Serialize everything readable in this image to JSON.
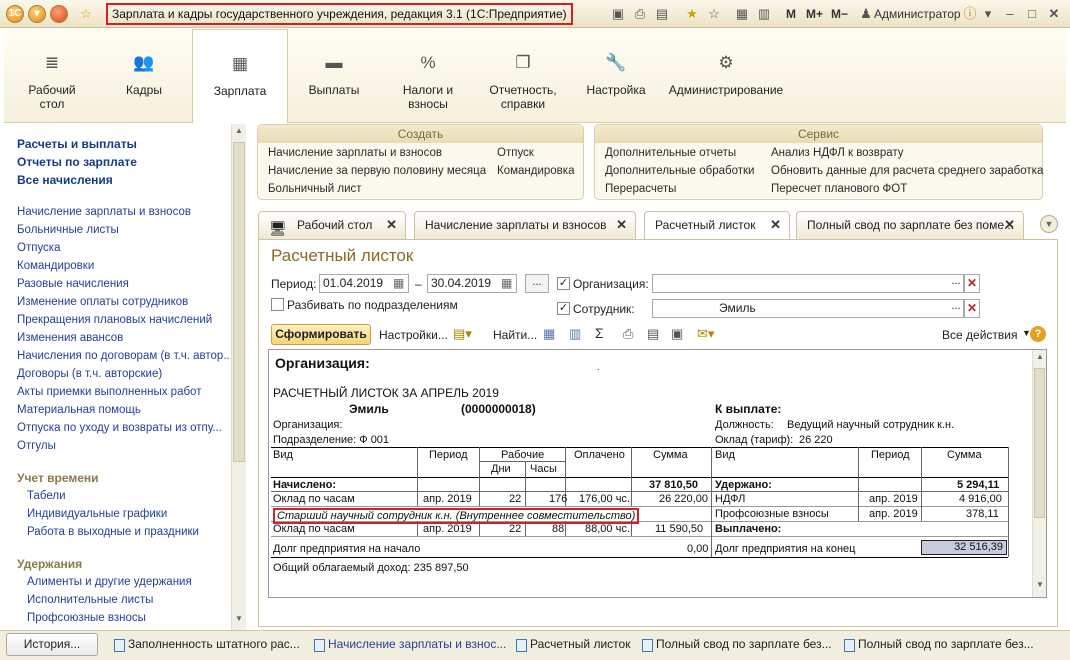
{
  "window": {
    "title": "Зарплата и кадры государственного учреждения, редакция 3.1 (1С:Предприятие)",
    "m_label": "M",
    "mplus_label": "M+",
    "mminus_label": "M−",
    "user": "Администратор"
  },
  "sections": [
    {
      "label": "Рабочий стол"
    },
    {
      "label": "Кадры"
    },
    {
      "label": "Зарплата"
    },
    {
      "label": "Выплаты"
    },
    {
      "label": "Налоги и взносы"
    },
    {
      "label": "Отчетность, справки"
    },
    {
      "label": "Настройка"
    },
    {
      "label": "Администрирование"
    }
  ],
  "left_panel": {
    "top_links": [
      "Расчеты и выплаты",
      "Отчеты по зарплате",
      "Все начисления"
    ],
    "links": [
      "Начисление зарплаты и взносов",
      "Больничные листы",
      "Отпуска",
      "Командировки",
      "Разовые начисления",
      "Изменение оплаты сотрудников",
      "Прекращения плановых начислений",
      "Изменения авансов",
      "Начисления по договорам (в т.ч. автор...",
      "Договоры (в т.ч. авторские)",
      "Акты приемки выполненных работ",
      "Материальная помощь",
      "Отпуска по уходу и возвраты из отпу...",
      "Отгулы"
    ],
    "time_head": "Учет времени",
    "time_links": [
      "Табели",
      "Индивидуальные графики",
      "Работа в выходные и праздники"
    ],
    "ded_head": "Удержания",
    "ded_links": [
      "Алименты и другие удержания",
      "Исполнительные листы",
      "Профсоюзные взносы"
    ]
  },
  "create": {
    "title": "Создать",
    "col1": [
      "Начисление зарплаты и взносов",
      "Начисление за первую половину месяца",
      "Больничный лист"
    ],
    "col2": [
      "Отпуск",
      "Командировка"
    ]
  },
  "service": {
    "title": "Сервис",
    "col1": [
      "Дополнительные отчеты",
      "Дополнительные обработки",
      "Перерасчеты"
    ],
    "col2": [
      "Анализ НДФЛ к возврату",
      "Обновить данные для расчета среднего заработка",
      "Пересчет планового ФОТ"
    ]
  },
  "tabs": [
    "Рабочий стол",
    "Начисление зарплаты и взносов",
    "Расчетный листок",
    "Полный свод по зарплате без поме..."
  ],
  "form": {
    "title": "Расчетный листок",
    "period_label": "Период:",
    "date_from": "01.04.2019",
    "dash": "–",
    "date_to": "30.04.2019",
    "ellipsis": "...",
    "split_label": "Разбивать по подразделениям",
    "org_label": "Организация:",
    "org_value": "",
    "emp_label": "Сотрудник:",
    "emp_value": "Эмиль",
    "generate": "Сформировать",
    "settings": "Настройки...",
    "find": "Найти...",
    "all_actions": "Все действия",
    "help": "?"
  },
  "report": {
    "org_header": "Организация:",
    "title": "РАСЧЕТНЫЙ ЛИСТОК ЗА АПРЕЛЬ 2019",
    "emp_name": "Эмиль",
    "emp_code": "(0000000018)",
    "to_pay": "К выплате:",
    "org_row": "Организация:",
    "position_label": "Должность:",
    "position": "Ведущий научный сотрудник к.н.",
    "dept": "Подразделение: Ф 001",
    "salary_label": "Оклад (тариф):",
    "salary": "26 220",
    "h_vid": "Вид",
    "h_period": "Период",
    "h_work": "Рабочие",
    "h_days": "Дни",
    "h_hours": "Часы",
    "h_paid": "Оплачено",
    "h_sum": "Сумма",
    "h_vid2": "Вид",
    "h_period2": "Период",
    "h_sum2": "Сумма",
    "accrued": "Начислено:",
    "accrued_sum": "37 810,50",
    "withheld": "Удержано:",
    "withheld_sum": "5 294,11",
    "r1": {
      "vid": "Оклад по часам",
      "period": "апр. 2019",
      "days": "22",
      "hours": "176",
      "paid": "176,00 чс.",
      "sum": "26 220,00"
    },
    "d1": {
      "vid": "НДФЛ",
      "period": "апр. 2019",
      "sum": "4 916,00"
    },
    "sub": "Старший научный сотрудник к.н. (Внутреннее совместительство)",
    "d2": {
      "vid": "Профсоюзные взносы",
      "period": "апр. 2019",
      "sum": "378,11"
    },
    "r2": {
      "vid": "Оклад по часам",
      "period": "апр. 2019",
      "days": "22",
      "hours": "88",
      "paid": "88,00 чс.",
      "sum": "11 590,50"
    },
    "paid_out": "Выплачено:",
    "debt_start": "Долг предприятия на начало",
    "debt_start_sum": "0,00",
    "debt_end": "Долг предприятия на конец",
    "debt_end_sum": "32 516,39",
    "income": "Общий облагаемый доход: 235 897,50"
  },
  "taskbar": {
    "history": "История...",
    "items": [
      "Заполненность штатного рас...",
      "Начисление зарплаты и взнос...",
      "Расчетный листок",
      "Полный свод по зарплате без...",
      "Полный свод по зарплате без..."
    ]
  }
}
